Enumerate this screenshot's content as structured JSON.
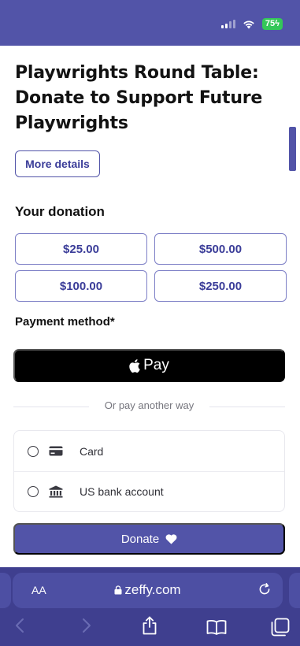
{
  "status_bar": {
    "battery": "75"
  },
  "page": {
    "title": "Playwrights Round Table: Donate to Support Future Playwrights",
    "more_details": "More details",
    "your_donation": "Your donation",
    "amounts": [
      "$25.00",
      "$500.00",
      "$100.00",
      "$250.00"
    ],
    "payment_method_label": "Payment method*",
    "apple_pay_label": "Pay",
    "divider_text": "Or pay another way",
    "methods": [
      {
        "label": "Card",
        "icon": "card-icon"
      },
      {
        "label": "US bank account",
        "icon": "bank-icon"
      }
    ],
    "donate_label": "Donate"
  },
  "browser": {
    "text_size_label": "AA",
    "domain": "zeffy.com"
  },
  "colors": {
    "brand": "#5254a8",
    "browser_chrome": "#3f3f8f",
    "battery": "#34c759"
  }
}
